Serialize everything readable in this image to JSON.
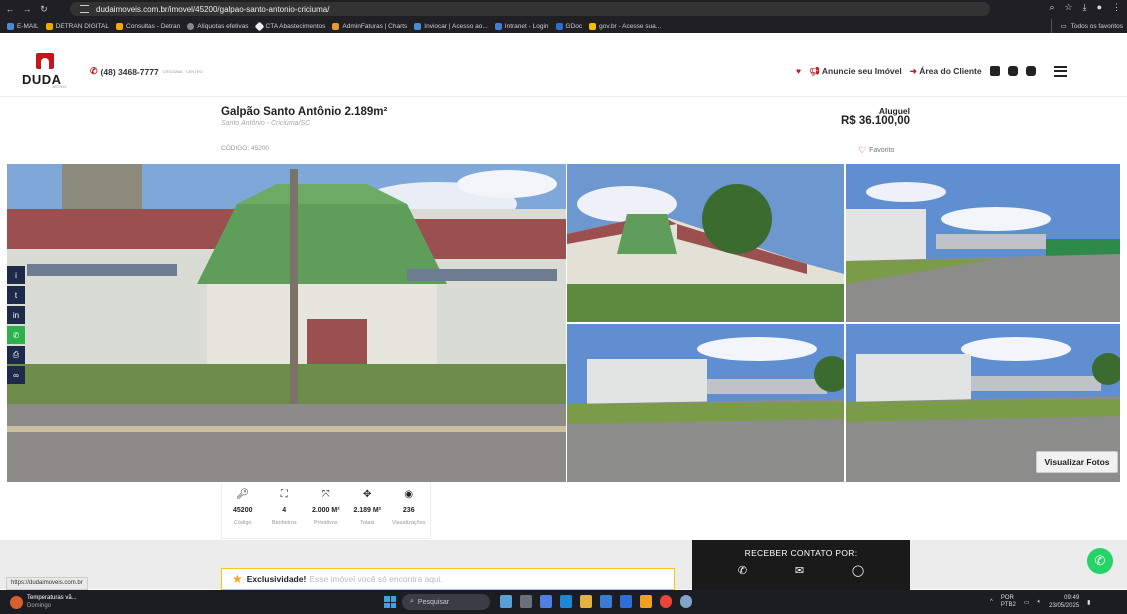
{
  "browser": {
    "url": "dudaimoveis.com.br/imovel/45200/galpao-santo-antonio-criciuma/",
    "bookmarks": [
      "E-MAIL",
      "DETRAN DIGITAL",
      "Consultas - Detran",
      "Alíquotas efetivas",
      "CTA Abastecimentos",
      "AdminFaturas | Charts",
      "Inviocar | Acesso ao...",
      "Intranet - Login",
      "GDoc",
      "gov.br - Acesse sua..."
    ],
    "all_bookmarks": "Todos os favoritos"
  },
  "header": {
    "logo": "DUDA",
    "logo_sub": "IMÓVEIS",
    "phone": "(48) 3468-7777",
    "phone_loc": "CRICIÚMA · CENTRO",
    "nav_announce": "Anuncie seu Imóvel",
    "nav_client": "Área do Cliente"
  },
  "listing": {
    "title": "Galpão Santo Antônio 2.189m²",
    "subtitle": "Santo Antônio - Criciúma/SC",
    "code": "CÓDIGO: 45200",
    "price_label": "Aluguel",
    "price": "R$ 36.100,00",
    "favorite": "Favorito",
    "view_photos": "Visualizar Fotos"
  },
  "specs": [
    {
      "icon": "key-icon",
      "value": "45200",
      "label": "Código"
    },
    {
      "icon": "shower-icon",
      "value": "4",
      "label": "Banheiros"
    },
    {
      "icon": "area-private-icon",
      "value": "2.000 M²",
      "label": "Privativos"
    },
    {
      "icon": "area-total-icon",
      "value": "2.189 M²",
      "label": "Totais"
    },
    {
      "icon": "eye-icon",
      "value": "236",
      "label": "Visualizações"
    }
  ],
  "exclusive": {
    "strong": "Exclusividade!",
    "text": "Esse imóvel você só encontra aqui."
  },
  "contact": {
    "title": "RECEBER CONTATO POR:"
  },
  "status_url": "https://dudaimoveis.com.br",
  "taskbar": {
    "weather_title": "Temperaturas vã...",
    "weather_sub": "Domingo",
    "search": "Pesquisar",
    "lang": "POR",
    "lang2": "PTB2",
    "time": "09:49",
    "date": "23/05/2025"
  }
}
